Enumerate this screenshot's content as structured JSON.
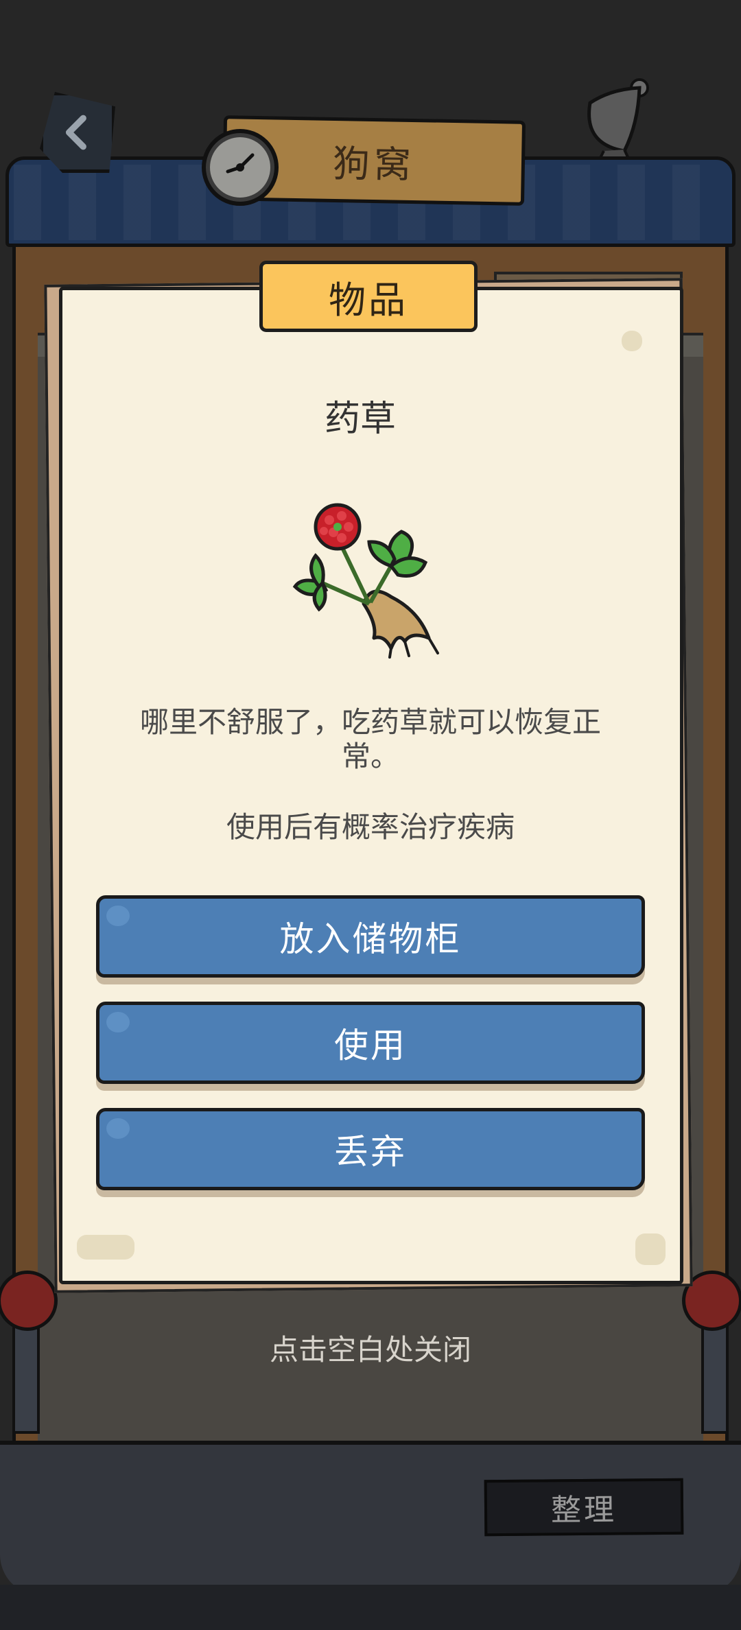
{
  "header": {
    "title": "狗窝"
  },
  "dialog": {
    "tab_label": "物品",
    "item_name": "药草",
    "item_icon": "medicinal-herb-icon",
    "description": "哪里不舒服了，吃药草就可以恢复正常。",
    "effect": "使用后有概率治疗疾病",
    "buttons": [
      {
        "label": "放入储物柜"
      },
      {
        "label": "使用"
      },
      {
        "label": "丢弃"
      }
    ]
  },
  "close_hint": "点击空白处关闭",
  "bottom_bar": {
    "sort_label": "整理"
  },
  "colors": {
    "button_blue": "#4d7fb5",
    "tab_yellow": "#fbc55c",
    "paper": "#f8f1de",
    "roof_blue": "#203556"
  }
}
